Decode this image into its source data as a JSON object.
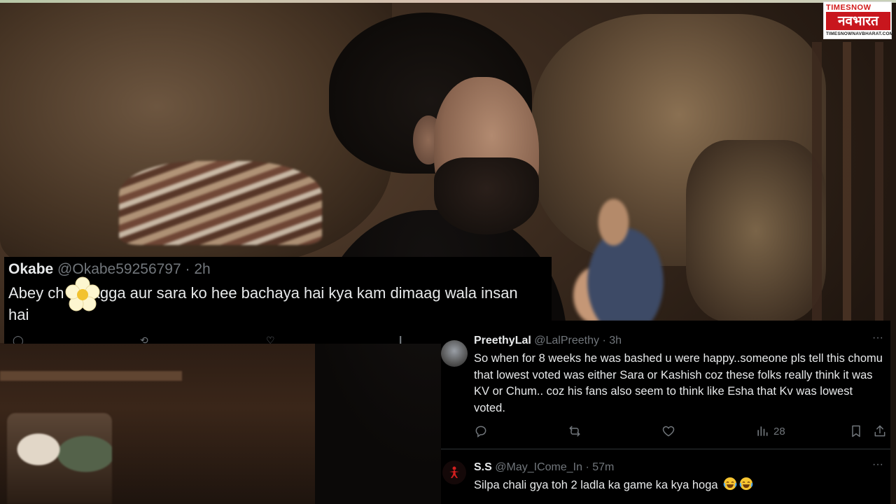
{
  "logo": {
    "brand_top": "TIMESNOW",
    "brand_main": "नवभारत",
    "brand_url": "TIMESNOWNAVBHARAT.COM"
  },
  "tweets": [
    {
      "display_name": "Okabe",
      "handle": "@Okabe59256797",
      "time": "2h",
      "text": "Abey ch    e Bagga aur sara ko hee bachaya hai kya kam dimaag wala insan hai",
      "overlay_icon": "flower-sticker-icon"
    },
    {
      "display_name": "PreethyLal",
      "handle": "@LalPreethy",
      "time": "3h",
      "text": "So when for 8 weeks he was bashed u were happy..someone pls tell this chomu that lowest voted was either Sara or Kashish coz these folks really think it was KV or Chum.. coz his fans also seem to think like Esha that Kv was lowest voted.",
      "views": "28",
      "icons": [
        "reply-icon",
        "retweet-icon",
        "like-icon",
        "views-icon",
        "bookmark-icon",
        "share-icon"
      ]
    },
    {
      "display_name": "S.S",
      "handle": "@May_ICome_In",
      "time": "57m",
      "text": "Silpa chali gya toh 2 ladla ka game ka kya hoga",
      "emoji": "laughing-tears-emoji"
    }
  ],
  "separator": "·",
  "more_glyph": "···"
}
